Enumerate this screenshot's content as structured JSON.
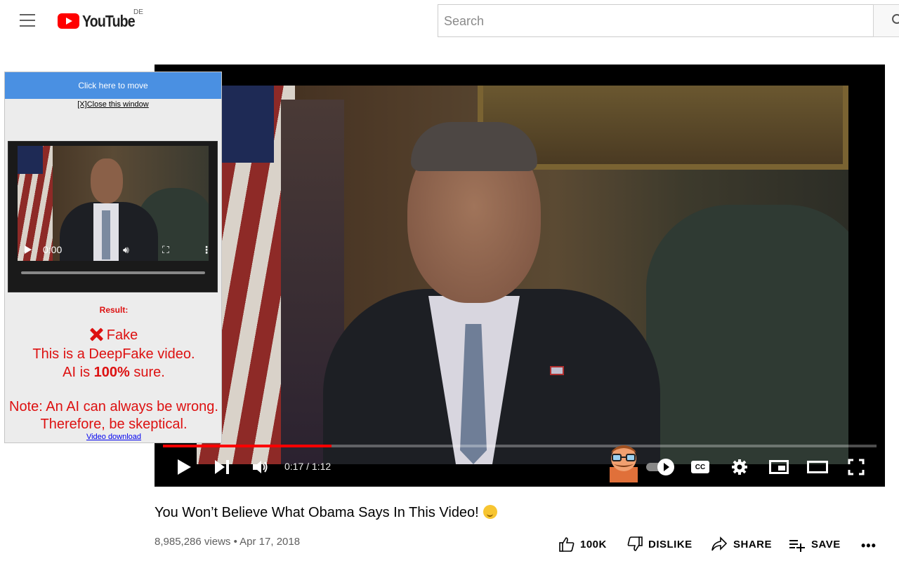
{
  "masthead": {
    "logo_text": "YouTube",
    "country_code": "DE",
    "search_placeholder": "Search"
  },
  "player": {
    "current_time": "0:17",
    "separator": " / ",
    "duration": "1:12",
    "progress": 0.236
  },
  "popup": {
    "move_label": "Click here to move",
    "close_label": "[X]Close this window",
    "mini_player_time": "0:00",
    "result_heading": "Result:",
    "verdict": "Fake",
    "line1": "This is a DeepFake video.",
    "line2_prefix": "AI is ",
    "line2_percent": "100%",
    "line2_suffix": " sure.",
    "note_line1": "Note: An AI can always be wrong.",
    "note_line2": "Therefore, be skeptical.",
    "download_label": "Video download"
  },
  "video": {
    "title": "You Won’t Believe What Obama Says In This Video!",
    "views": "8,985,286 views",
    "bullet": " • ",
    "date": "Apr 17, 2018"
  },
  "actions": {
    "like_label": "100K",
    "dislike_label": "DISLIKE",
    "share_label": "SHARE",
    "save_label": "SAVE"
  },
  "colors": {
    "brand_red": "#ff0000",
    "popup_move_blue": "#4a90e2",
    "result_red": "#dd1111"
  }
}
